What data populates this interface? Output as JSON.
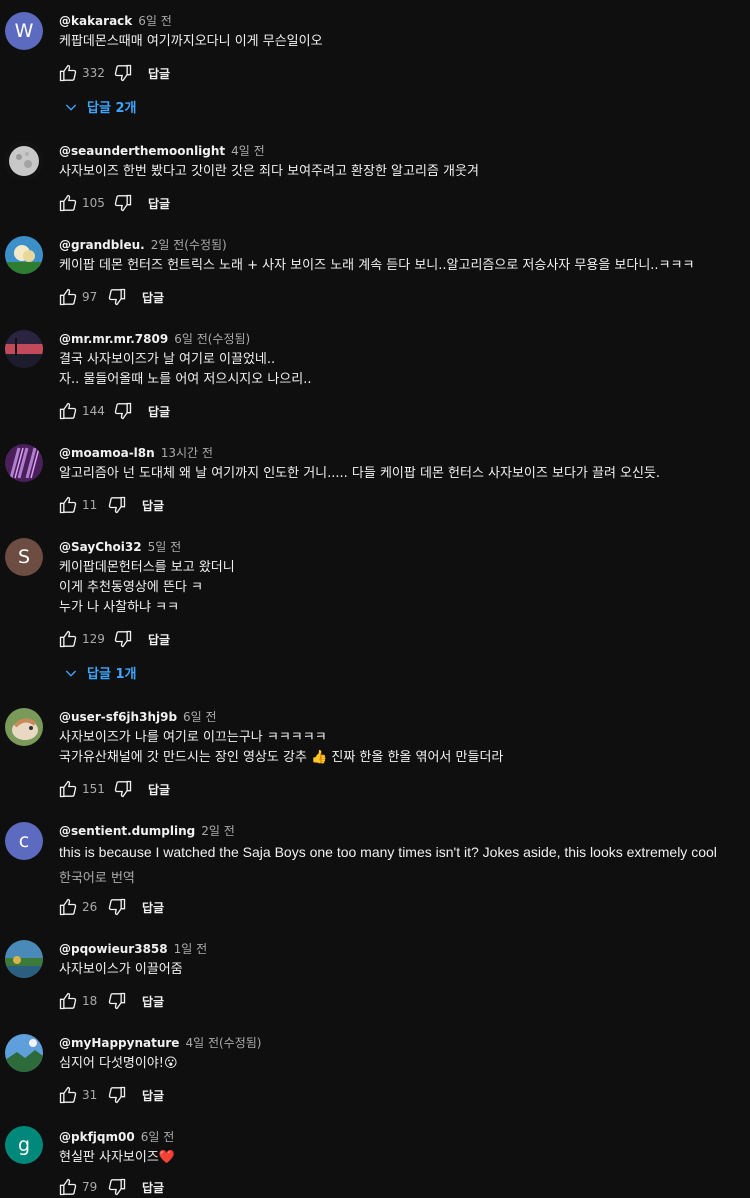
{
  "comments": [
    {
      "handle": "@kakarack",
      "time": "6일 전",
      "lines": [
        "케팝데몬스때매 여기까지오다니 이게 무슨일이오"
      ],
      "likes": "332",
      "reply_label": "답글",
      "replies": "답글 2개",
      "avatar_letter": "W",
      "avatar_color": "#5c6bc0"
    },
    {
      "handle": "@seaunderthemoonlight",
      "time": "4일 전",
      "lines": [
        "사자보이즈 한번 봤다고 갓이란 갓은 죄다 보여주려고 환장한 알고리즘 개웃겨"
      ],
      "likes": "105",
      "reply_label": "답글",
      "avatar_color": "#3a3a3a"
    },
    {
      "handle": "@grandbleu.",
      "time": "2일 전(수정됨)",
      "lines": [
        "케이팝 데몬 헌터즈 헌트릭스 노래 + 사자 보이즈 노래 계속 듣다 보니..알고리즘으로 저승사자 무용을 보다니..ㅋㅋㅋ"
      ],
      "likes": "97",
      "reply_label": "답글",
      "avatar_color": "#2a7fb8"
    },
    {
      "handle": "@mr.mr.mr.7809",
      "time": "6일 전(수정됨)",
      "lines": [
        "결국 사자보이즈가 날 여기로 이끌었네..",
        "자.. 물들어올때 노를 어여 저으시지오 나으리.."
      ],
      "likes": "144",
      "reply_label": "답글",
      "avatar_color": "#3b2a4a"
    },
    {
      "handle": "@moamoa-l8n",
      "time": "13시간 전",
      "lines": [
        "알고리즘아 넌 도대체 왜 날 여기까지 인도한 거니..... 다들 케이팝 데몬 헌터스 사자보이즈 보다가 끌려 오신듯."
      ],
      "likes": "11",
      "reply_label": "답글",
      "avatar_color": "#5a2a6a"
    },
    {
      "handle": "@SayChoi32",
      "time": "5일 전",
      "lines": [
        "케이팝데몬헌터스를 보고 왔더니",
        "이게 추천동영상에 뜬다 ㅋ",
        "누가 나 사찰하냐 ㅋㅋ"
      ],
      "likes": "129",
      "reply_label": "답글",
      "replies": "답글 1개",
      "avatar_letter": "S",
      "avatar_color": "#6d4c41"
    },
    {
      "handle": "@user-sf6jh3hj9b",
      "time": "6일 전",
      "lines": [
        "사자보이즈가 나를 여기로 이끄는구나 ㅋㅋㅋㅋㅋ",
        "국가유산채널에 갓 만드시는 장인 영상도 강추 👍 진짜 한올 한올 엮어서 만들더라"
      ],
      "likes": "151",
      "reply_label": "답글",
      "avatar_color": "#c98b5a"
    },
    {
      "handle": "@sentient.dumpling",
      "time": "2일 전",
      "lines": [
        "this is because I watched the Saja Boys one too many times isn't it? Jokes aside, this looks extremely cool"
      ],
      "translate": "한국어로 번역",
      "likes": "26",
      "reply_label": "답글",
      "avatar_letter": "c",
      "avatar_color": "#5c6bc0"
    },
    {
      "handle": "@pqowieur3858",
      "time": "1일 전",
      "lines": [
        "사자보이스가 이끌어줌"
      ],
      "likes": "18",
      "reply_label": "답글",
      "avatar_color": "#2f6f8f"
    },
    {
      "handle": "@myHappynature",
      "time": "4일 전(수정됨)",
      "lines": [
        "심지어 다섯명이야!😮"
      ],
      "likes": "31",
      "reply_label": "답글",
      "avatar_color": "#4a86c8"
    },
    {
      "handle": "@pkfjqm00",
      "time": "6일 전",
      "lines": [
        "현실판 사자보이즈❤️"
      ],
      "likes": "79",
      "reply_label": "답글",
      "avatar_letter": "g",
      "avatar_color": "#00897b"
    }
  ]
}
